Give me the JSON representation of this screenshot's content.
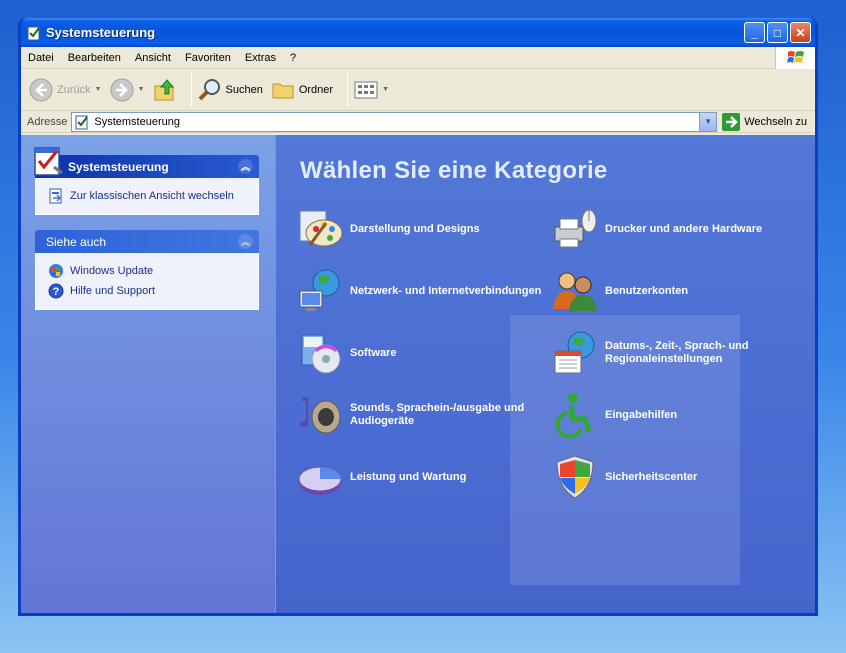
{
  "window": {
    "title": "Systemsteuerung",
    "controls": {
      "minimize": "_",
      "maximize": "□",
      "close": "✕"
    }
  },
  "menu": [
    "Datei",
    "Bearbeiten",
    "Ansicht",
    "Favoriten",
    "Extras",
    "?"
  ],
  "toolbar": {
    "back": "Zurück",
    "search": "Suchen",
    "folders": "Ordner"
  },
  "address": {
    "label": "Adresse",
    "value": "Systemsteuerung",
    "go": "Wechseln zu"
  },
  "sidebar": {
    "panel1": {
      "title": "Systemsteuerung",
      "links": [
        {
          "label": "Zur klassischen Ansicht wechseln",
          "icon": "classic-view-icon"
        }
      ]
    },
    "panel2": {
      "title": "Siehe auch",
      "links": [
        {
          "label": "Windows Update",
          "icon": "windows-update-icon"
        },
        {
          "label": "Hilfe und Support",
          "icon": "help-icon"
        }
      ]
    }
  },
  "content": {
    "heading": "Wählen Sie eine Kategorie",
    "categories": [
      {
        "label": "Darstellung und Designs",
        "icon": "palette-icon"
      },
      {
        "label": "Drucker und andere Hardware",
        "icon": "printer-icon"
      },
      {
        "label": "Netzwerk- und Internetverbindungen",
        "icon": "network-icon"
      },
      {
        "label": "Benutzerkonten",
        "icon": "users-icon"
      },
      {
        "label": "Software",
        "icon": "software-icon"
      },
      {
        "label": "Datums-, Zeit-, Sprach- und Regionaleinstellungen",
        "icon": "globe-calendar-icon"
      },
      {
        "label": "Sounds, Sprachein-/ausgabe und Audiogeräte",
        "icon": "speaker-icon"
      },
      {
        "label": "Eingabehilfen",
        "icon": "accessibility-icon"
      },
      {
        "label": "Leistung und Wartung",
        "icon": "pie-chart-icon"
      },
      {
        "label": "Sicherheitscenter",
        "icon": "shield-icon"
      }
    ]
  },
  "colors": {
    "accent": "#0a5ee8",
    "content_bg": "#4b6cd2",
    "sidebar_bg": "#7ba2e7"
  }
}
